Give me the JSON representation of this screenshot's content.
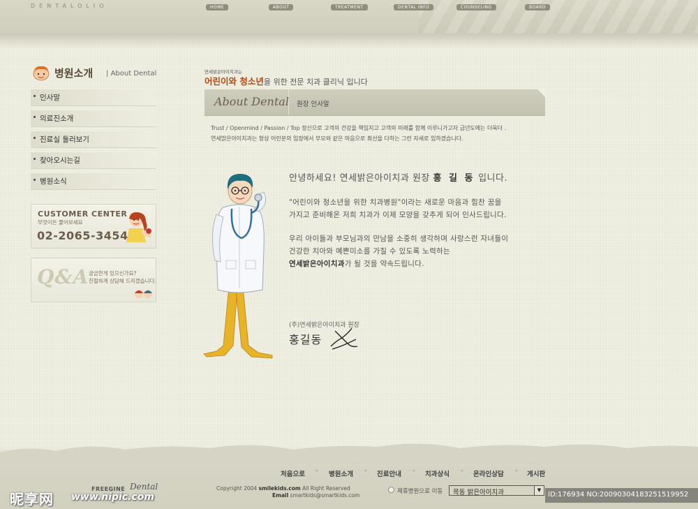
{
  "header": {
    "logo_subtitle": "DENTALOLIO",
    "nav": [
      "HOME",
      "ABOUT",
      "TREATMENT",
      "DENTAL INFO",
      "COUNSELING",
      "BOARD"
    ]
  },
  "sidebar": {
    "title_kr": "병원소개",
    "title_en": "About Dental",
    "items": [
      {
        "label": "인사말"
      },
      {
        "label": "의료진소개"
      },
      {
        "label": "진료실 둘러보기"
      },
      {
        "label": "찾아오시는길"
      },
      {
        "label": "병원소식"
      }
    ],
    "customer_center": {
      "title": "CUSTOMER CENTER",
      "subtitle": "무엇이든 물어보세요",
      "phone": "02-2065-3454"
    },
    "qa": {
      "logo": "Q&A",
      "line1": "궁금한게 있으신가요?",
      "line2": "친절하게 상담해 드리겠습니다."
    }
  },
  "main": {
    "tag_small": "연세밝은아이치과는",
    "tag_highlight": "어린이와 청소년",
    "tag_rest": "을 위한 전문 치과 클리닉 입니다",
    "header_en": "About Dental",
    "header_kr": "원장 인사말",
    "motto_line1": "Trust / Openmind / Passion / Top 정신으로 고객의 건강을 책임지고 고객의 미래를 함께 이루니가고자 금년도에는 더욱더 .",
    "motto_line2": "연세밝은아이치과는 항상 어린분의 입장에서 부모와 같은 마음으로 최선을 다하는 그런 자세로 임하겠습니다.",
    "greeting_pre": "안녕하세요! 연세밝은아이치과 원장 ",
    "greeting_name": "홍 길 동",
    "greeting_post": " 입니다.",
    "para1_line1": "\"어린이와 청소년을 위한 치과병원\"이라는 새로운 마음과 힘찬 꿈을",
    "para1_line2": "가지고 준비해온 저희 치과가 이제 모양을 갖추게 되어 인사드립니다.",
    "para2_line1": "우리 아이들과 부모님과의 만남을 소중히 생각하며 사랑스런 자녀들이",
    "para2_line2": "건강한 치아와 예쁜미소를 가질 수 있도록 노력하는",
    "para2_line3_bold": "연세밝은아이치과",
    "para2_line3_rest": "가 될 것을 약속드립니다.",
    "signature_role": "(주)연세밝은아이치과 원장",
    "signature_name": "홍길동"
  },
  "footer": {
    "nav": [
      "처음으로",
      "병원소개",
      "진료안내",
      "치과상식",
      "온라인상담",
      "게시판"
    ],
    "logo": "FREEGINE",
    "logo_script": "Dental",
    "copyright_pre": "Copyright 2004 ",
    "copyright_site": "smilekids.com",
    "copyright_post": " All Right Reserved",
    "email_label": "Email",
    "email": "smartkids@smartkids.com",
    "family_label": "제휴병원으로 이동",
    "family_selected": "목동 밝은아이치과"
  },
  "watermark": {
    "brand": "昵享网",
    "url": "www.nipic.com",
    "id": "ID:176934 NO:20090304183251519952"
  },
  "colors": {
    "accent": "#b04a14",
    "header_bar": "#c9c7b6",
    "nav_pill": "#8f8d7b"
  }
}
